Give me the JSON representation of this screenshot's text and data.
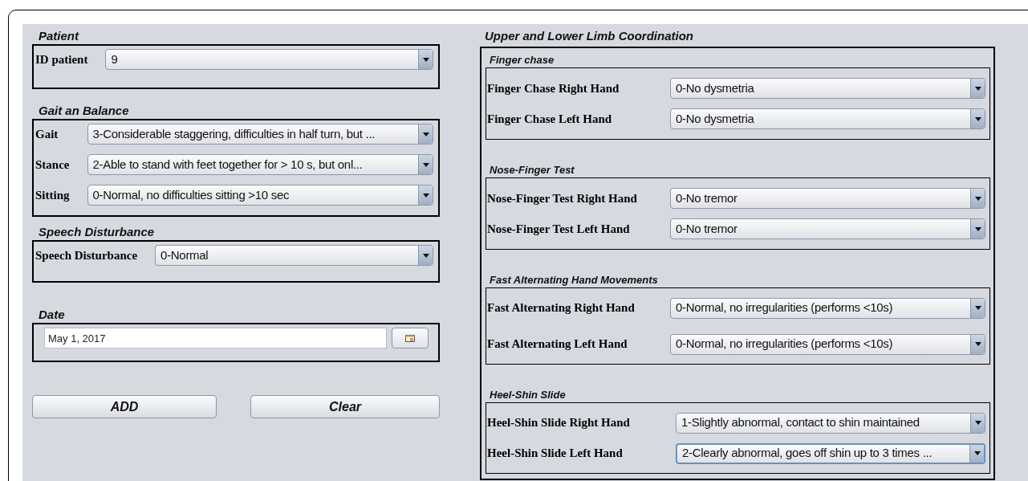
{
  "left_sections": [
    {
      "title": "Patient",
      "fields": [
        {
          "kind": "dropdown",
          "label": "ID patient",
          "value": "9",
          "focused": false
        }
      ]
    },
    {
      "title": "Gait an Balance",
      "fields": [
        {
          "kind": "dropdown",
          "label": "Gait",
          "value": "3-Considerable staggering, difficulties in half turn, but ...",
          "focused": false
        },
        {
          "kind": "dropdown",
          "label": "Stance",
          "value": "2-Able to stand with feet together for > 10 s, but onl...",
          "focused": false
        },
        {
          "kind": "dropdown",
          "label": "Sitting",
          "value": "0-Normal, no difficulties sitting >10 sec",
          "focused": false
        }
      ]
    },
    {
      "title": "Speech Disturbance",
      "fields": [
        {
          "kind": "dropdown",
          "label": "Speech Disturbance",
          "value": "0-Normal",
          "focused": false
        }
      ]
    },
    {
      "title": "Date",
      "fields": [
        {
          "kind": "date",
          "value": "May 1, 2017"
        }
      ]
    }
  ],
  "buttons": [
    "ADD",
    "Clear"
  ],
  "right_panel": {
    "title": "Upper and Lower Limb Coordination",
    "groups": [
      {
        "title": "Finger chase",
        "fields": [
          {
            "kind": "dropdown",
            "label": "Finger Chase Right Hand",
            "value": "0-No dysmetria",
            "focused": false
          },
          {
            "kind": "dropdown",
            "label": "Finger Chase Left Hand",
            "value": "0-No dysmetria",
            "focused": false
          }
        ]
      },
      {
        "title": "Nose-Finger Test",
        "fields": [
          {
            "kind": "dropdown",
            "label": "Nose-Finger Test Right Hand",
            "value": "0-No tremor",
            "focused": false
          },
          {
            "kind": "dropdown",
            "label": "Nose-Finger Test Left Hand",
            "value": "0-No tremor",
            "focused": false
          }
        ]
      },
      {
        "title": "Fast Alternating Hand Movements",
        "fields": [
          {
            "kind": "dropdown",
            "label": "Fast Alternating Right Hand",
            "value": "0-Normal, no irregularities (performs <10s)",
            "focused": false
          },
          {
            "kind": "dropdown",
            "label": "Fast Alternating Left Hand",
            "value": "0-Normal, no irregularities (performs <10s)",
            "focused": false
          }
        ]
      },
      {
        "title": "Heel-Shin Slide",
        "fields": [
          {
            "kind": "dropdown",
            "label": "Heel-Shin Slide Right Hand",
            "value": "1-Slightly abnormal, contact to shin maintained",
            "focused": false
          },
          {
            "kind": "dropdown",
            "label": "Heel-Shin Slide Left Hand",
            "value": "2-Clearly abnormal, goes off shin up to 3 times ...",
            "focused": true
          }
        ]
      }
    ]
  }
}
